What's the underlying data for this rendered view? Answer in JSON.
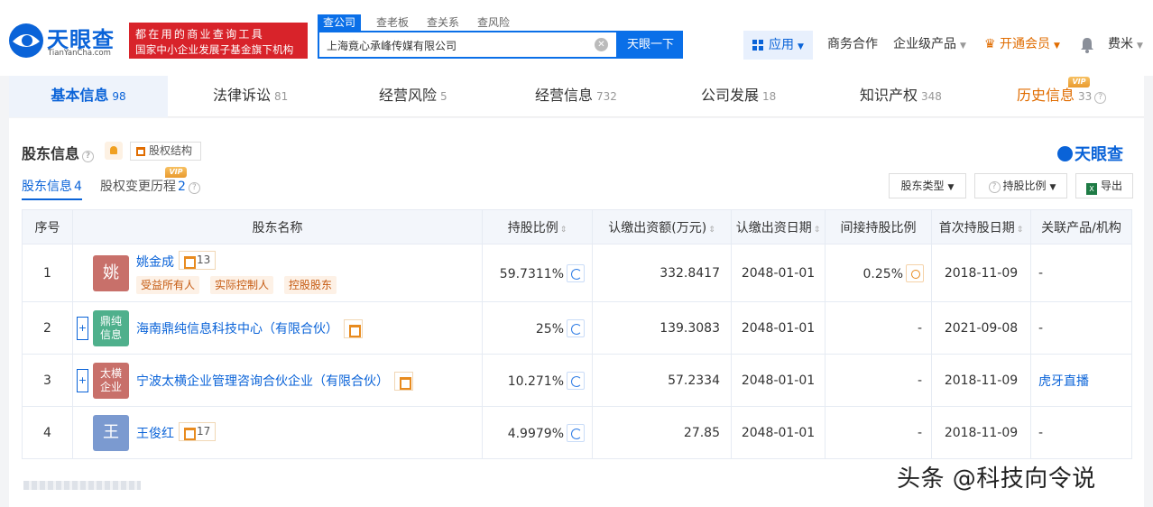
{
  "header": {
    "logo_cn": "天眼查",
    "logo_en": "TianYanCha.com",
    "banner_line1": "都在用的商业查询工具",
    "banner_line2": "国家中小企业发展子基金旗下机构",
    "search_tabs": [
      "查公司",
      "查老板",
      "查关系",
      "查风险"
    ],
    "search_value": "上海竟心承峰传媒有限公司",
    "search_button": "天眼一下",
    "apps_label": "应用",
    "nav": {
      "business": "商务合作",
      "enterprise": "企业级产品",
      "vip": "开通会员",
      "user": "费米"
    },
    "colors": {
      "brand": "#0a63d8",
      "banner": "#d8232a",
      "vip": "#e06c00"
    }
  },
  "main_tabs": [
    {
      "label": "基本信息",
      "count": "98"
    },
    {
      "label": "法律诉讼",
      "count": "81"
    },
    {
      "label": "经营风险",
      "count": "5"
    },
    {
      "label": "经营信息",
      "count": "732"
    },
    {
      "label": "公司发展",
      "count": "18"
    },
    {
      "label": "知识产权",
      "count": "348"
    },
    {
      "label": "历史信息",
      "count": "33"
    }
  ],
  "vip_badge": "VIP",
  "section": {
    "title": "股东信息",
    "structure_button": "股权结构",
    "watermark_logo": "天眼查",
    "subtabs": [
      {
        "label": "股东信息",
        "count": "4"
      },
      {
        "label": "股权变更历程",
        "count": "2"
      }
    ],
    "filter_type": "股东类型",
    "filter_ratio": "持股比例",
    "export": "导出"
  },
  "table": {
    "headers": [
      "序号",
      "股东名称",
      "持股比例",
      "认缴出资额(万元)",
      "认缴出资日期",
      "间接持股比例",
      "首次持股日期",
      "关联产品/机构"
    ],
    "rows": [
      {
        "no": "1",
        "avatar": "姚",
        "name": "姚金成",
        "chip": "13",
        "tags": [
          "受益所有人",
          "实际控制人",
          "控股股东"
        ],
        "ratio": "59.7311%",
        "amount": "332.8417",
        "date": "2048-01-01",
        "indirect": "0.25%",
        "first": "2018-11-09",
        "related": "-"
      },
      {
        "no": "2",
        "avatar_l1": "鼎纯",
        "avatar_l2": "信息",
        "name": "海南鼎纯信息科技中心（有限合伙）",
        "ratio": "25%",
        "amount": "139.3083",
        "date": "2048-01-01",
        "indirect": "-",
        "first": "2021-09-08",
        "related": "-"
      },
      {
        "no": "3",
        "avatar_l1": "太横",
        "avatar_l2": "企业",
        "name": "宁波太横企业管理咨询合伙企业（有限合伙）",
        "ratio": "10.271%",
        "amount": "57.2334",
        "date": "2048-01-01",
        "indirect": "-",
        "first": "2018-11-09",
        "related": "虎牙直播"
      },
      {
        "no": "4",
        "avatar": "王",
        "name": "王俊红",
        "chip": "17",
        "ratio": "4.9979%",
        "amount": "27.85",
        "date": "2048-01-01",
        "indirect": "-",
        "first": "2018-11-09",
        "related": "-"
      }
    ],
    "avatar_colors": [
      "#c8706a",
      "#4fb08c",
      "#c8706a",
      "#7b9ad0"
    ]
  },
  "watermark": "头条 @科技向令说"
}
